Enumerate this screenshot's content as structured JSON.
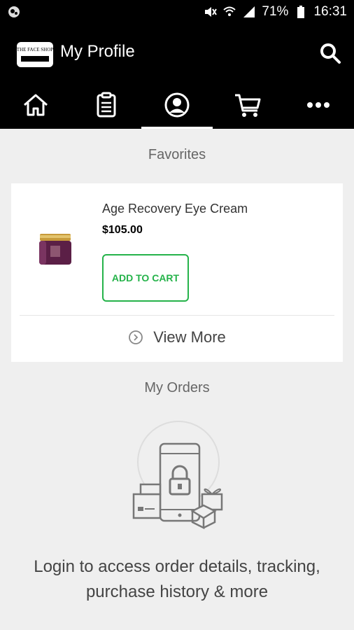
{
  "status_bar": {
    "battery": "71%",
    "time": "16:31",
    "icons": [
      "notification-icon",
      "mute-icon",
      "wifi-icon",
      "signal-icon",
      "battery-icon"
    ]
  },
  "app_bar": {
    "title": "My Profile",
    "logo_text": "THE FACE SHOP",
    "icons": [
      "brand-logo",
      "search-icon"
    ]
  },
  "tabs": [
    {
      "name": "home",
      "icon": "home-icon"
    },
    {
      "name": "orders",
      "icon": "clipboard-icon"
    },
    {
      "name": "profile",
      "icon": "profile-icon",
      "selected": true
    },
    {
      "name": "cart",
      "icon": "cart-icon"
    },
    {
      "name": "more",
      "icon": "more-icon"
    }
  ],
  "favorites": {
    "title": "Favorites",
    "item": {
      "name": "Age Recovery Eye Cream",
      "price": "$105.00",
      "button_label": "ADD TO CART"
    },
    "view_more_label": "View More"
  },
  "orders": {
    "title": "My Orders",
    "login_message": "Login to access order details, tracking,\npurchase history & more"
  },
  "colors": {
    "header_bg": "#000000",
    "page_bg": "#efefef",
    "accent": "#25b34a"
  }
}
